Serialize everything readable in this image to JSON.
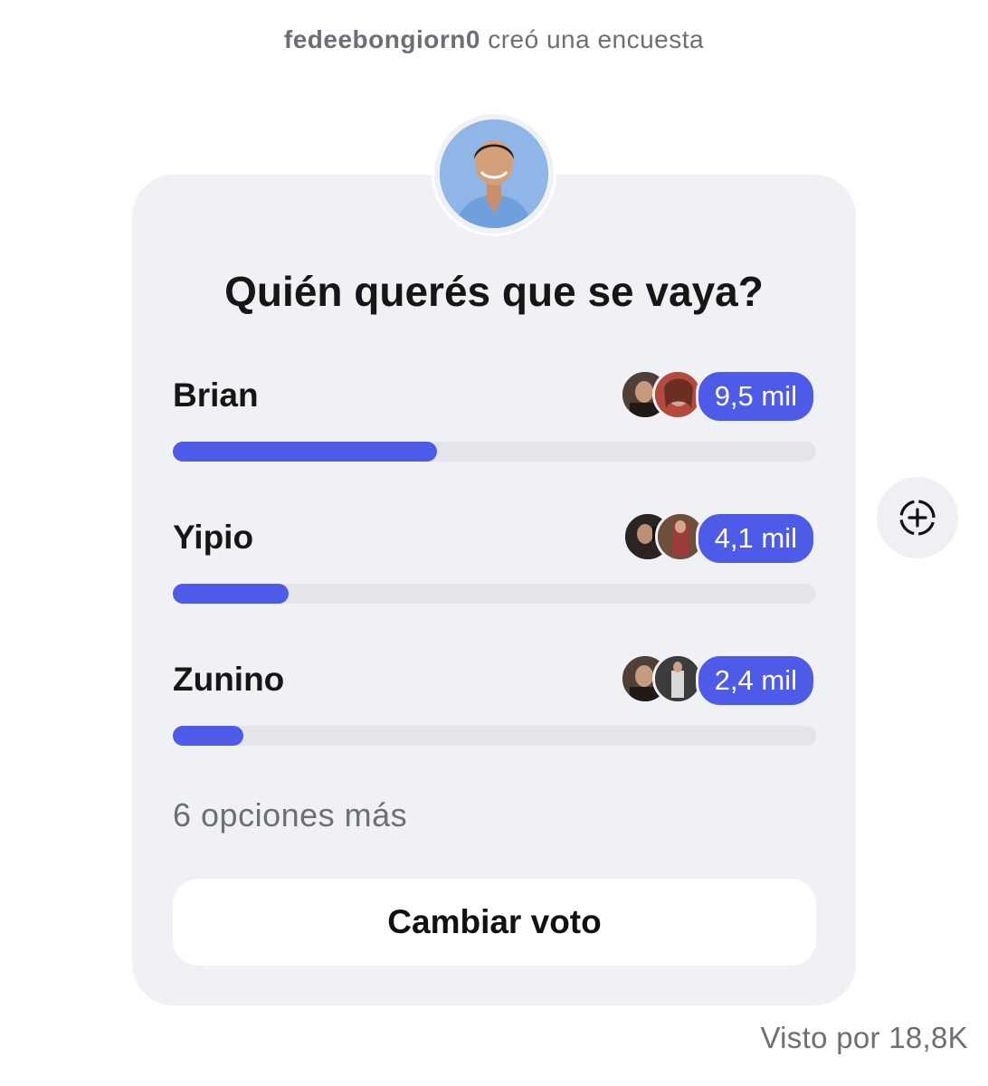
{
  "header": {
    "username": "fedeebongiorn0",
    "action_text": " creó una encuesta"
  },
  "poll": {
    "question": "Quién querés que se vaya?",
    "options": [
      {
        "label": "Brian",
        "count": "9,5 mil",
        "fraction": 0.41
      },
      {
        "label": "Yipio",
        "count": "4,1 mil",
        "fraction": 0.18
      },
      {
        "label": "Zunino",
        "count": "2,4 mil",
        "fraction": 0.11
      }
    ],
    "more_options": "6 opciones más",
    "change_vote_label": "Cambiar voto"
  },
  "footer": {
    "seen_by": "Visto por 18,8K"
  },
  "icons": {
    "add_story": "dashed-circle-plus-icon"
  },
  "colors": {
    "accent": "#4e5ae8",
    "card_bg": "#f0f1f5",
    "muted_text": "#6b6f76"
  }
}
